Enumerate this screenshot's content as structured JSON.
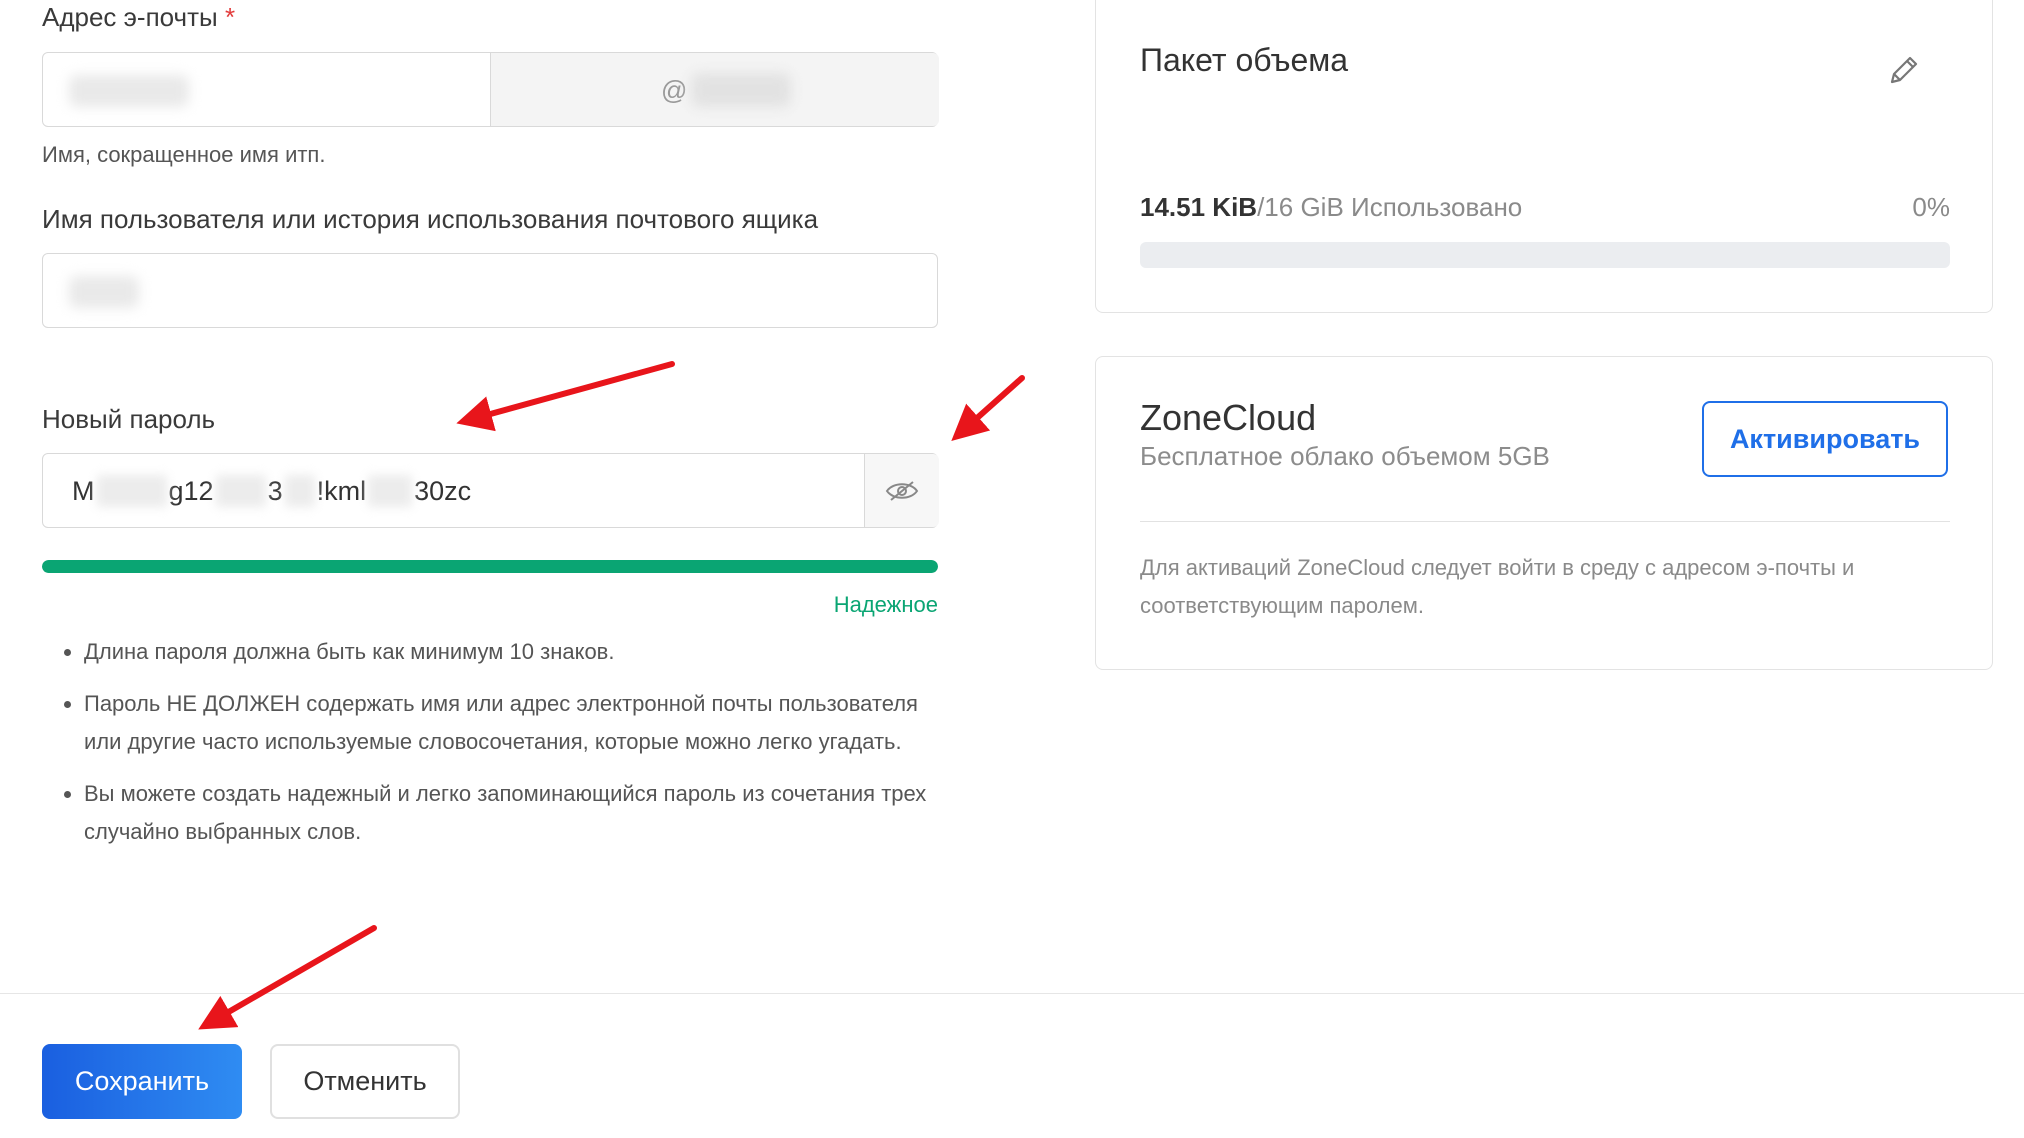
{
  "email": {
    "label": "Адрес э-почты",
    "required_mark": "*",
    "domain_prefix": "@",
    "help": "Имя, сокращенное имя итп."
  },
  "username": {
    "label": "Имя пользователя или история использования почтового ящика"
  },
  "password": {
    "label": "Новый пароль",
    "value_parts": [
      "M",
      "g12",
      "3",
      "!kml",
      "30zc"
    ],
    "strength_label": "Надежное",
    "strength_fraction": 1.0,
    "strength_color": "#0aa573",
    "rules": [
      "Длина пароля должна быть как минимум 10 знаков.",
      "Пароль НЕ ДОЛЖЕН содержать имя или адрес электронной почты пользователя или другие часто используемые словосочетания, которые можно легко угадать.",
      "Вы можете создать надежный и легко запоминающийся пароль из сочетания трех случайно выбранных слов."
    ]
  },
  "quota": {
    "title": "Пакет объема",
    "used": "14.51 KiB",
    "total": "/16 GiB Использовано",
    "percent": "0%"
  },
  "zonecloud": {
    "title": "ZoneCloud",
    "subtitle": "Бесплатное облако объемом 5GB",
    "activate_label": "Активировать",
    "note": "Для активаций ZoneCloud следует войти в среду с адресом э-почты и соответствующим паролем."
  },
  "footer": {
    "save_label": "Сохранить",
    "cancel_label": "Отменить"
  },
  "colors": {
    "primary": "#1f6fe8",
    "success": "#0aa573",
    "annotation_arrow": "#e8151b"
  }
}
